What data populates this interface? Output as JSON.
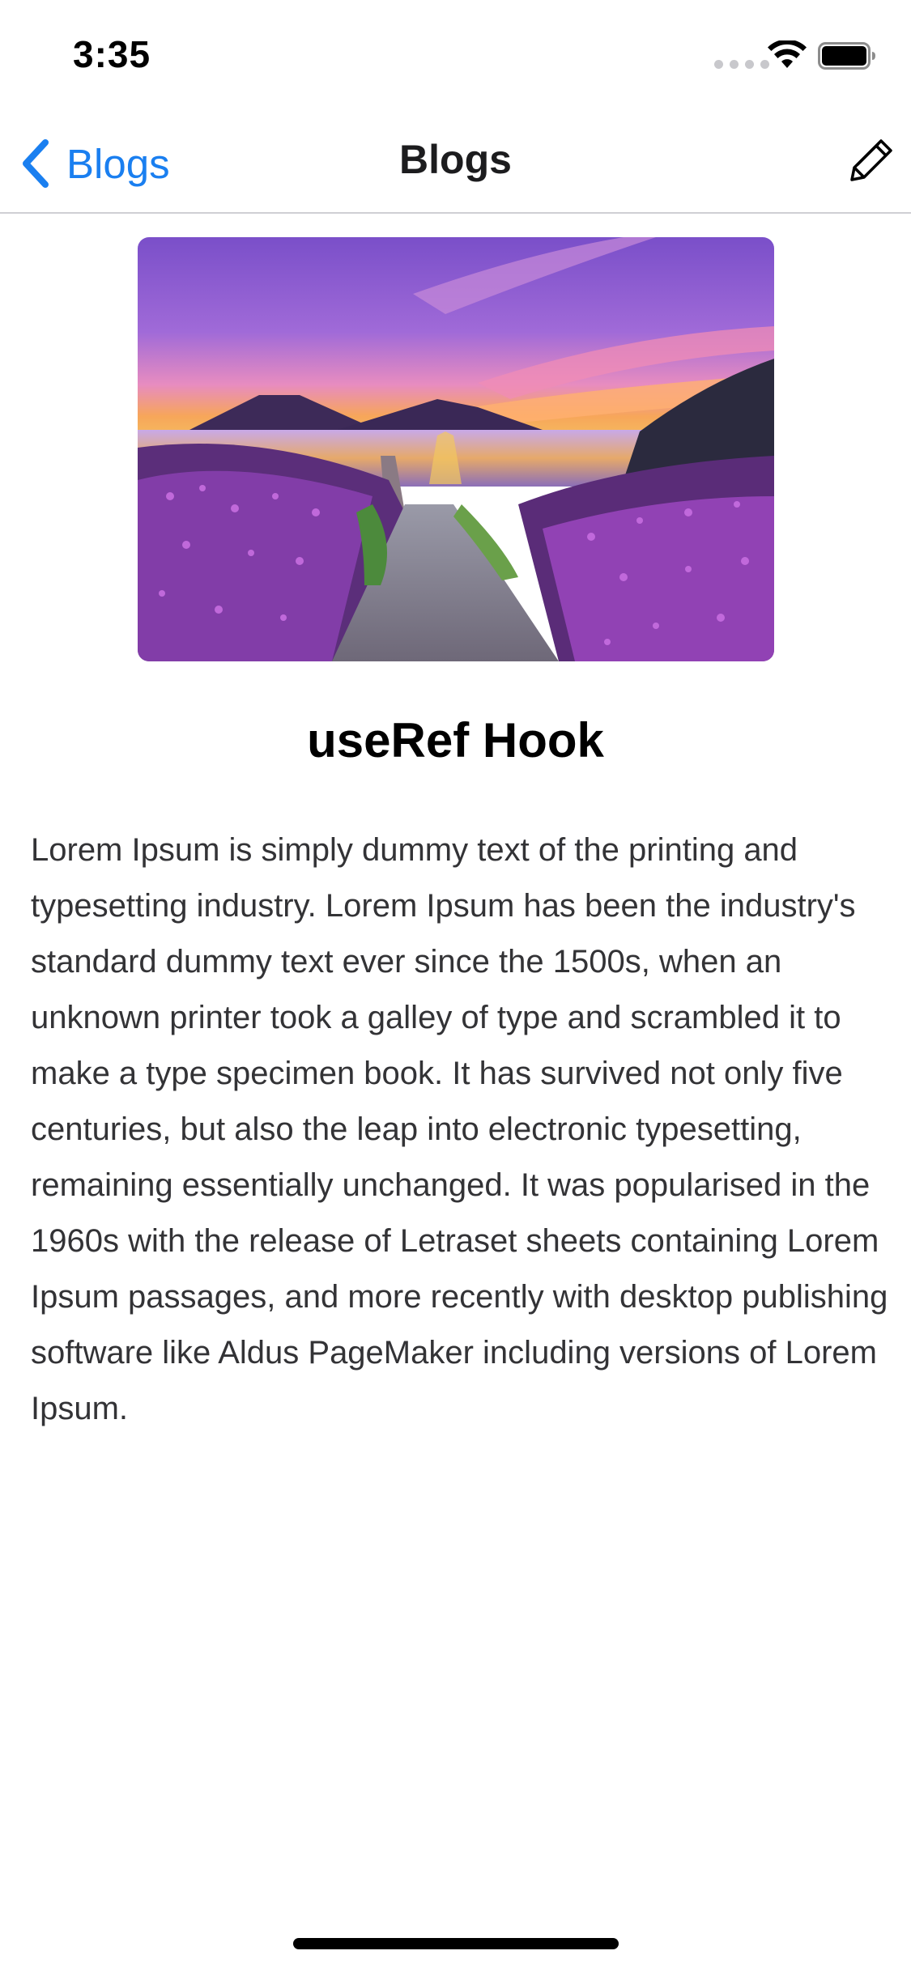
{
  "status_bar": {
    "time": "3:35",
    "signal_icon": "signal-dots-icon",
    "wifi_icon": "wifi-icon",
    "battery_icon": "battery-icon"
  },
  "nav": {
    "back_label": "Blogs",
    "back_icon": "chevron-left-icon",
    "title": "Blogs",
    "edit_icon": "pencil-icon",
    "accent_color": "#1a7ff0"
  },
  "post": {
    "image_description_icon": "landscape-photo",
    "title": "useRef Hook",
    "body": "Lorem Ipsum is simply dummy text of the printing and typesetting industry. Lorem Ipsum has been the industry's standard dummy text ever since the 1500s, when an unknown printer took a galley of type and scrambled it to make a type specimen book. It has survived not only five centuries, but also the leap into electronic typesetting, remaining essentially unchanged. It was popularised in the 1960s with the release of Letraset sheets containing Lorem Ipsum passages, and more recently with desktop publishing software like Aldus PageMaker including versions of Lorem Ipsum."
  }
}
